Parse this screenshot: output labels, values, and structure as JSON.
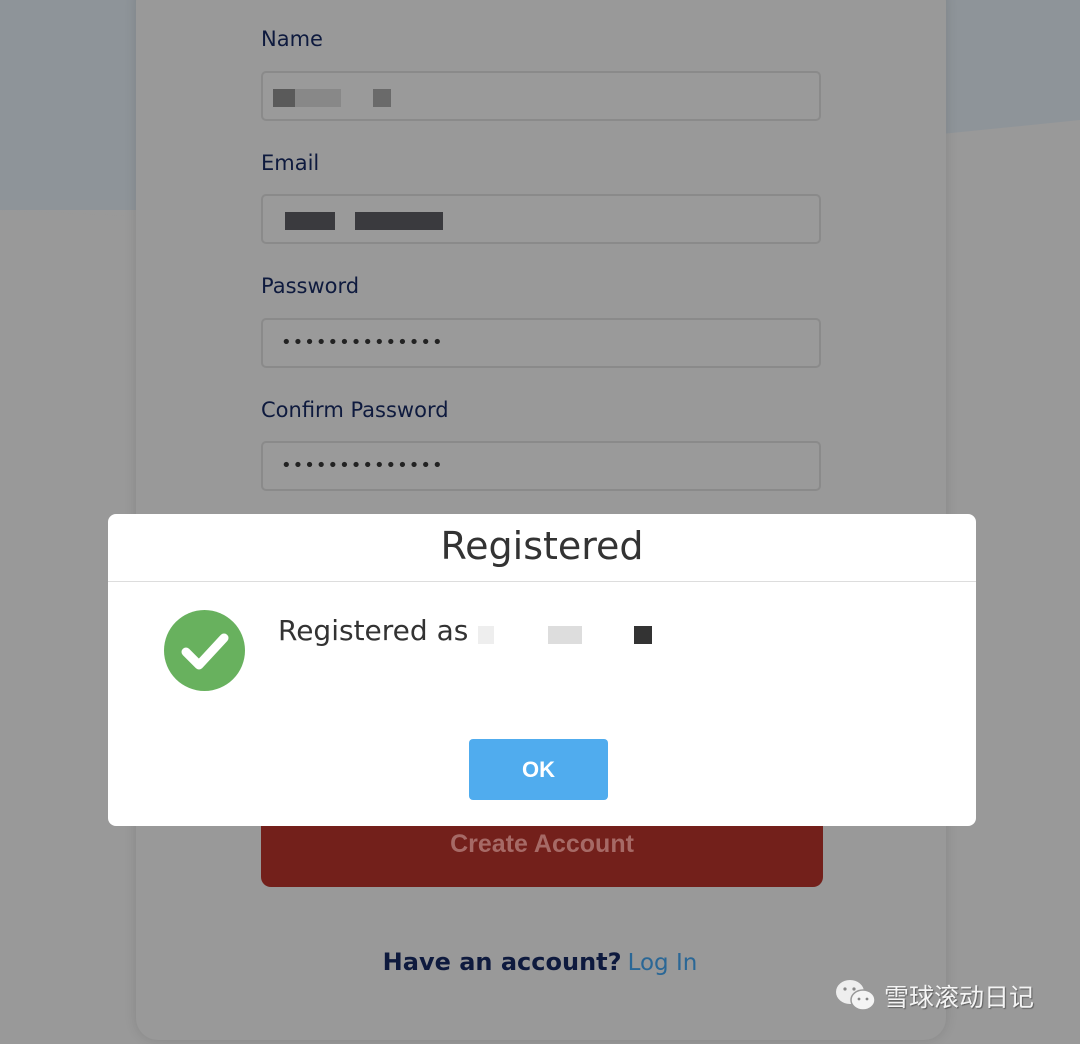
{
  "form": {
    "name_label": "Name",
    "email_label": "Email",
    "password_label": "Password",
    "password_value": "••••••••••••••",
    "confirm_label": "Confirm Password",
    "confirm_value": "••••••••••••••",
    "create_button": "Create Account",
    "have_account": "Have an account?",
    "login_link": "Log In"
  },
  "dialog": {
    "title": "Registered",
    "message": "Registered as",
    "icon": "check-circle-icon",
    "ok_button": "OK",
    "success_color": "#68b15e",
    "button_color": "#50acee"
  },
  "watermark": {
    "text": "雪球滚动日记",
    "icon": "wechat-icon"
  }
}
